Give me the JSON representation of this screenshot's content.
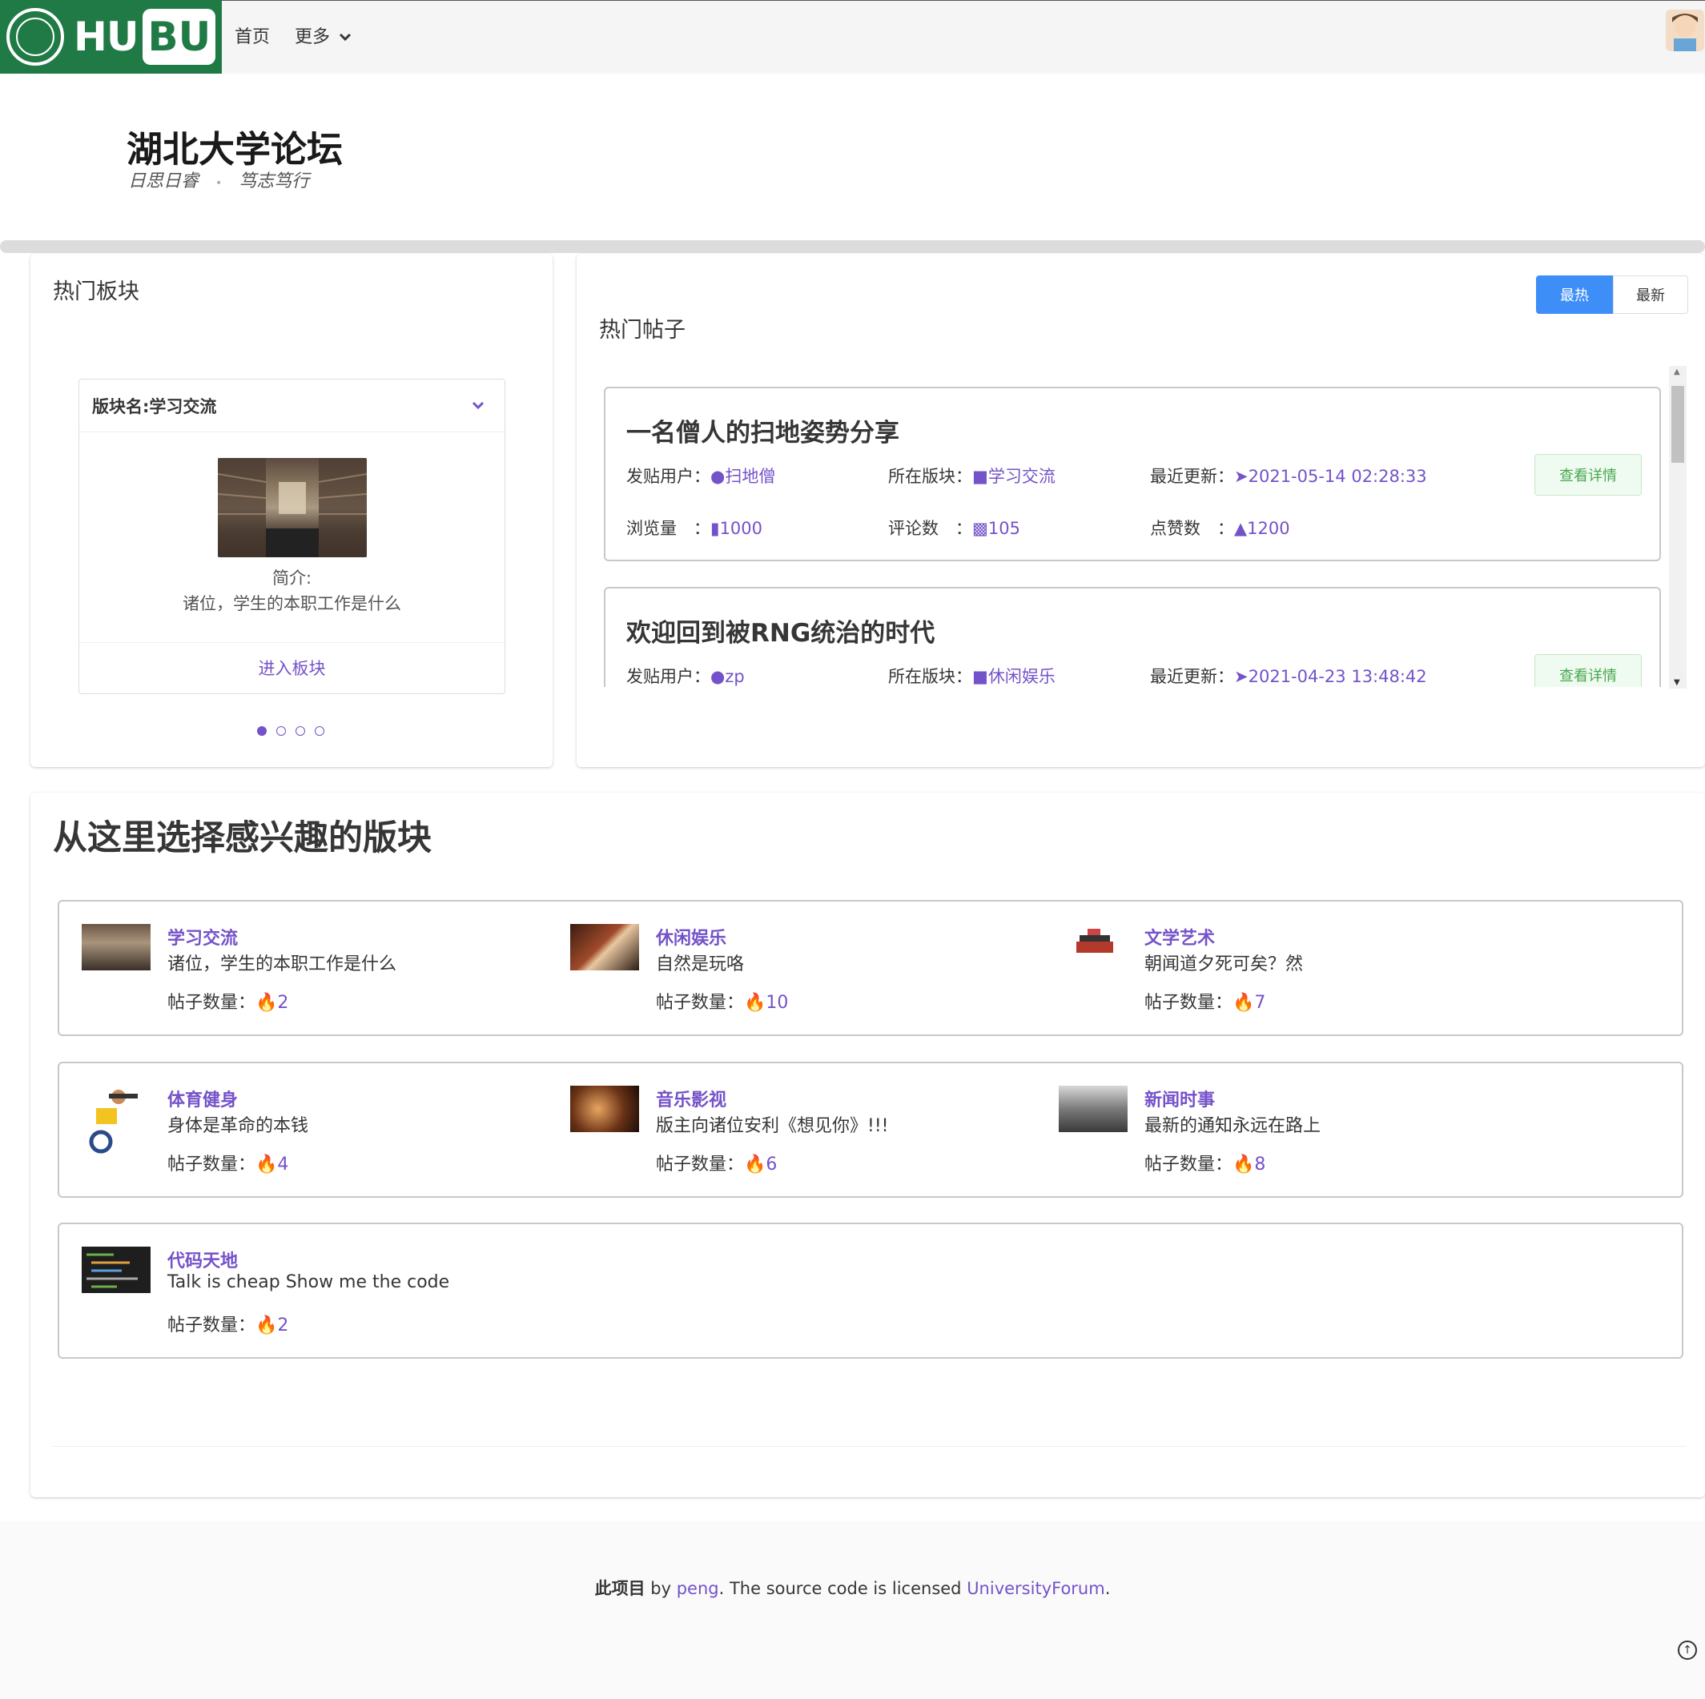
{
  "nav": {
    "logo_hu": "HU",
    "logo_bu": "BU",
    "home": "首页",
    "more": "更多"
  },
  "hero": {
    "title": "湖北大学论坛",
    "motto_1": "日思日睿",
    "motto_sep": "•",
    "motto_2": "笃志笃行"
  },
  "hot_boards": {
    "title": "热门板块",
    "card": {
      "name": "版块名:学习交流",
      "intro_label": "简介:",
      "intro": "诸位，学生的本职工作是什么",
      "enter": "进入板块"
    },
    "dots": 4,
    "active_dot": 0
  },
  "hot_posts": {
    "title": "热门帖子",
    "tab_hot": "最热",
    "tab_new": "最新",
    "labels": {
      "user": "发贴用户：",
      "board": "所在版块：",
      "updated": "最近更新：",
      "views": "浏览量　：",
      "comments": "评论数　：",
      "likes": "点赞数　：",
      "detail": "查看详情"
    },
    "posts": [
      {
        "title": "一名僧人的扫地姿势分享",
        "user": "扫地僧",
        "board": "学习交流",
        "updated": "2021-05-14 02:28:33",
        "views": "1000",
        "comments": "105",
        "likes": "1200"
      },
      {
        "title": "欢迎回到被RNG统治的时代",
        "user": "zp",
        "board": "休闲娱乐",
        "updated": "2021-04-23 13:48:42"
      }
    ]
  },
  "boards": {
    "title": "从这里选择感兴趣的版块",
    "count_label": "帖子数量：",
    "items": [
      {
        "name": "学习交流",
        "desc": "诸位，学生的本职工作是什么",
        "count": "2"
      },
      {
        "name": "休闲娱乐",
        "desc": "自然是玩咯",
        "count": "10"
      },
      {
        "name": "文学艺术",
        "desc": "朝闻道夕死可矣？然",
        "count": "7"
      },
      {
        "name": "体育健身",
        "desc": "身体是革命的本钱",
        "count": "4"
      },
      {
        "name": "音乐影视",
        "desc": "版主向诸位安利《想见你》!!!",
        "count": "6"
      },
      {
        "name": "新闻时事",
        "desc": "最新的通知永远在路上",
        "count": "8"
      },
      {
        "name": "代码天地",
        "desc": "Talk is cheap Show me the code",
        "count": "2"
      }
    ]
  },
  "footer": {
    "project": "此项目",
    "by": " by ",
    "author": "peng",
    "mid": ". The source code is licensed ",
    "license": "UniversityForum",
    "end": "."
  },
  "colors": {
    "brand_green": "#1f7a45",
    "accent": "#7452c9",
    "primary_blue": "#3e8ef7",
    "success_green": "#48a84f"
  }
}
